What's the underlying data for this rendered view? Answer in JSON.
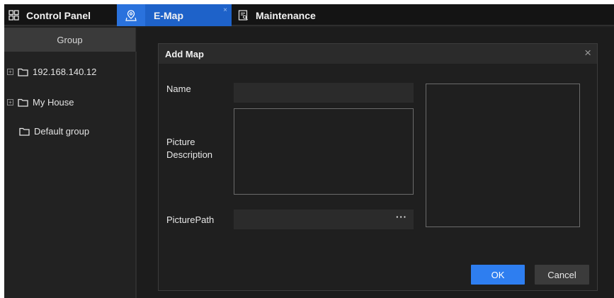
{
  "tabs": {
    "control_panel": "Control Panel",
    "emap": "E-Map",
    "emap_close": "×",
    "maintenance": "Maintenance"
  },
  "sidebar": {
    "header": "Group",
    "items": [
      {
        "label": "192.168.140.12",
        "expander": "+"
      },
      {
        "label": "My House",
        "expander": "+"
      },
      {
        "label": "Default group"
      }
    ]
  },
  "dialog": {
    "title": "Add Map",
    "close": "×",
    "name_label": "Name",
    "name_value": "",
    "desc_label_1": "Picture",
    "desc_label_2": "Description",
    "desc_value": "",
    "path_label": "PicturePath",
    "path_value": "",
    "browse": "···",
    "ok": "OK",
    "cancel": "Cancel"
  },
  "colors": {
    "accent": "#1e62c9",
    "ok_button": "#2e7ef0",
    "background": "#1f1f1f"
  }
}
